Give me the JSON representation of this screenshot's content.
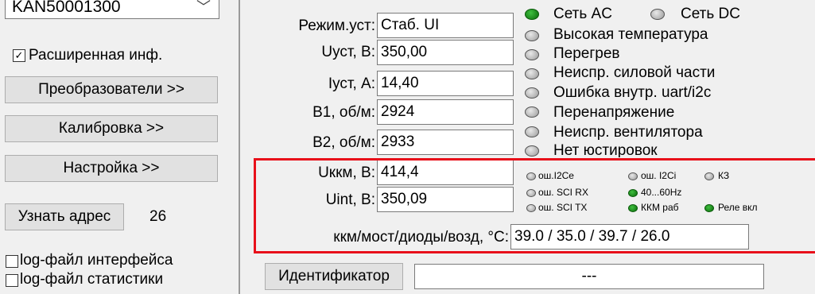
{
  "left": {
    "device_combo_value": "KAN50001300",
    "extended_info": {
      "label": "Расширенная инф.",
      "checked": true
    },
    "buttons": {
      "converters": "Преобразователи >>",
      "calibration": "Калибровка >>",
      "settings": "Настройка >>"
    },
    "address": {
      "button": "Узнать адрес",
      "value": "26"
    },
    "logs": {
      "interface": {
        "label": "log-файл интерфейса",
        "checked": false
      },
      "statistics": {
        "label": "log-файл статистики",
        "checked": false
      }
    }
  },
  "params": [
    {
      "label": "Режим.уст:",
      "value": "Стаб. UI"
    },
    {
      "label": "Uуст, В:",
      "value": "350,00"
    },
    {
      "label": "Iуст, А:",
      "value": "14,40"
    },
    {
      "label": "B1, об/м:",
      "value": "2924"
    },
    {
      "label": "B2, об/м:",
      "value": "2933"
    },
    {
      "label": "Uккм, В:",
      "value": "414,4"
    },
    {
      "label": "Uint, В:",
      "value": "350,09"
    }
  ],
  "temps": {
    "label": "ккм/мост/диоды/возд, °C:",
    "value": "39.0 / 35.0 / 39.7 / 26.0"
  },
  "status_leds": {
    "ac": {
      "label": "Сеть AC",
      "on": true
    },
    "dc": {
      "label": "Сеть DC",
      "on": false
    },
    "list": [
      {
        "label": "Высокая температура",
        "on": false
      },
      {
        "label": "Перегрев",
        "on": false
      },
      {
        "label": "Неиспр. силовой части",
        "on": false
      },
      {
        "label": "Ошибка внутр. uart/i2c",
        "on": false
      },
      {
        "label": "Перенапряжение",
        "on": false
      },
      {
        "label": "Неиспр. вентилятора",
        "on": false
      },
      {
        "label": "Нет юстировок",
        "on": false
      }
    ]
  },
  "small_leds": [
    {
      "label": "ош.I2Ce",
      "on": false
    },
    {
      "label": "ош. I2Ci",
      "on": false
    },
    {
      "label": "КЗ",
      "on": false
    },
    {
      "label": "ош. SCI RX",
      "on": false
    },
    {
      "label": "40...60Hz",
      "on": true
    },
    {
      "label": "ош. SCI TX",
      "on": false
    },
    {
      "label": "ККМ раб",
      "on": true
    },
    {
      "label": "Реле вкл",
      "on": true
    }
  ],
  "identifier": {
    "button": "Идентификатор",
    "value": "---"
  },
  "colors": {
    "led_on": "#1a8a1a",
    "highlight_box": "#e8101a"
  }
}
